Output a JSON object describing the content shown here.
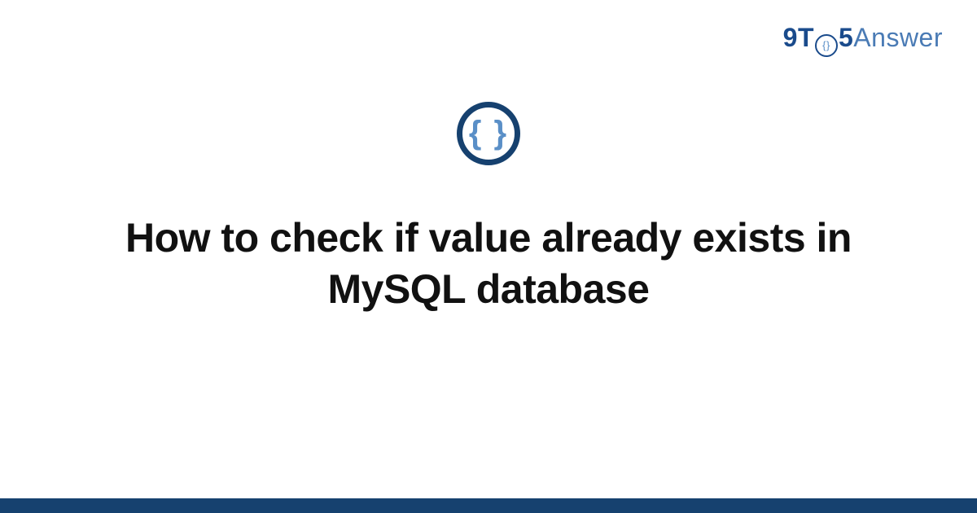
{
  "header": {
    "logo": {
      "part1": "9T",
      "circle_inner": "{}",
      "part2": "5",
      "part3": "Answer"
    }
  },
  "main": {
    "category_icon": {
      "symbol": "{ }",
      "name": "code-braces-icon"
    },
    "title": "How to check if value already exists in MySQL database"
  },
  "colors": {
    "brand_dark": "#16416f",
    "brand_mid": "#1a4b8c",
    "brand_light": "#5a8fc7",
    "text": "#111111"
  }
}
